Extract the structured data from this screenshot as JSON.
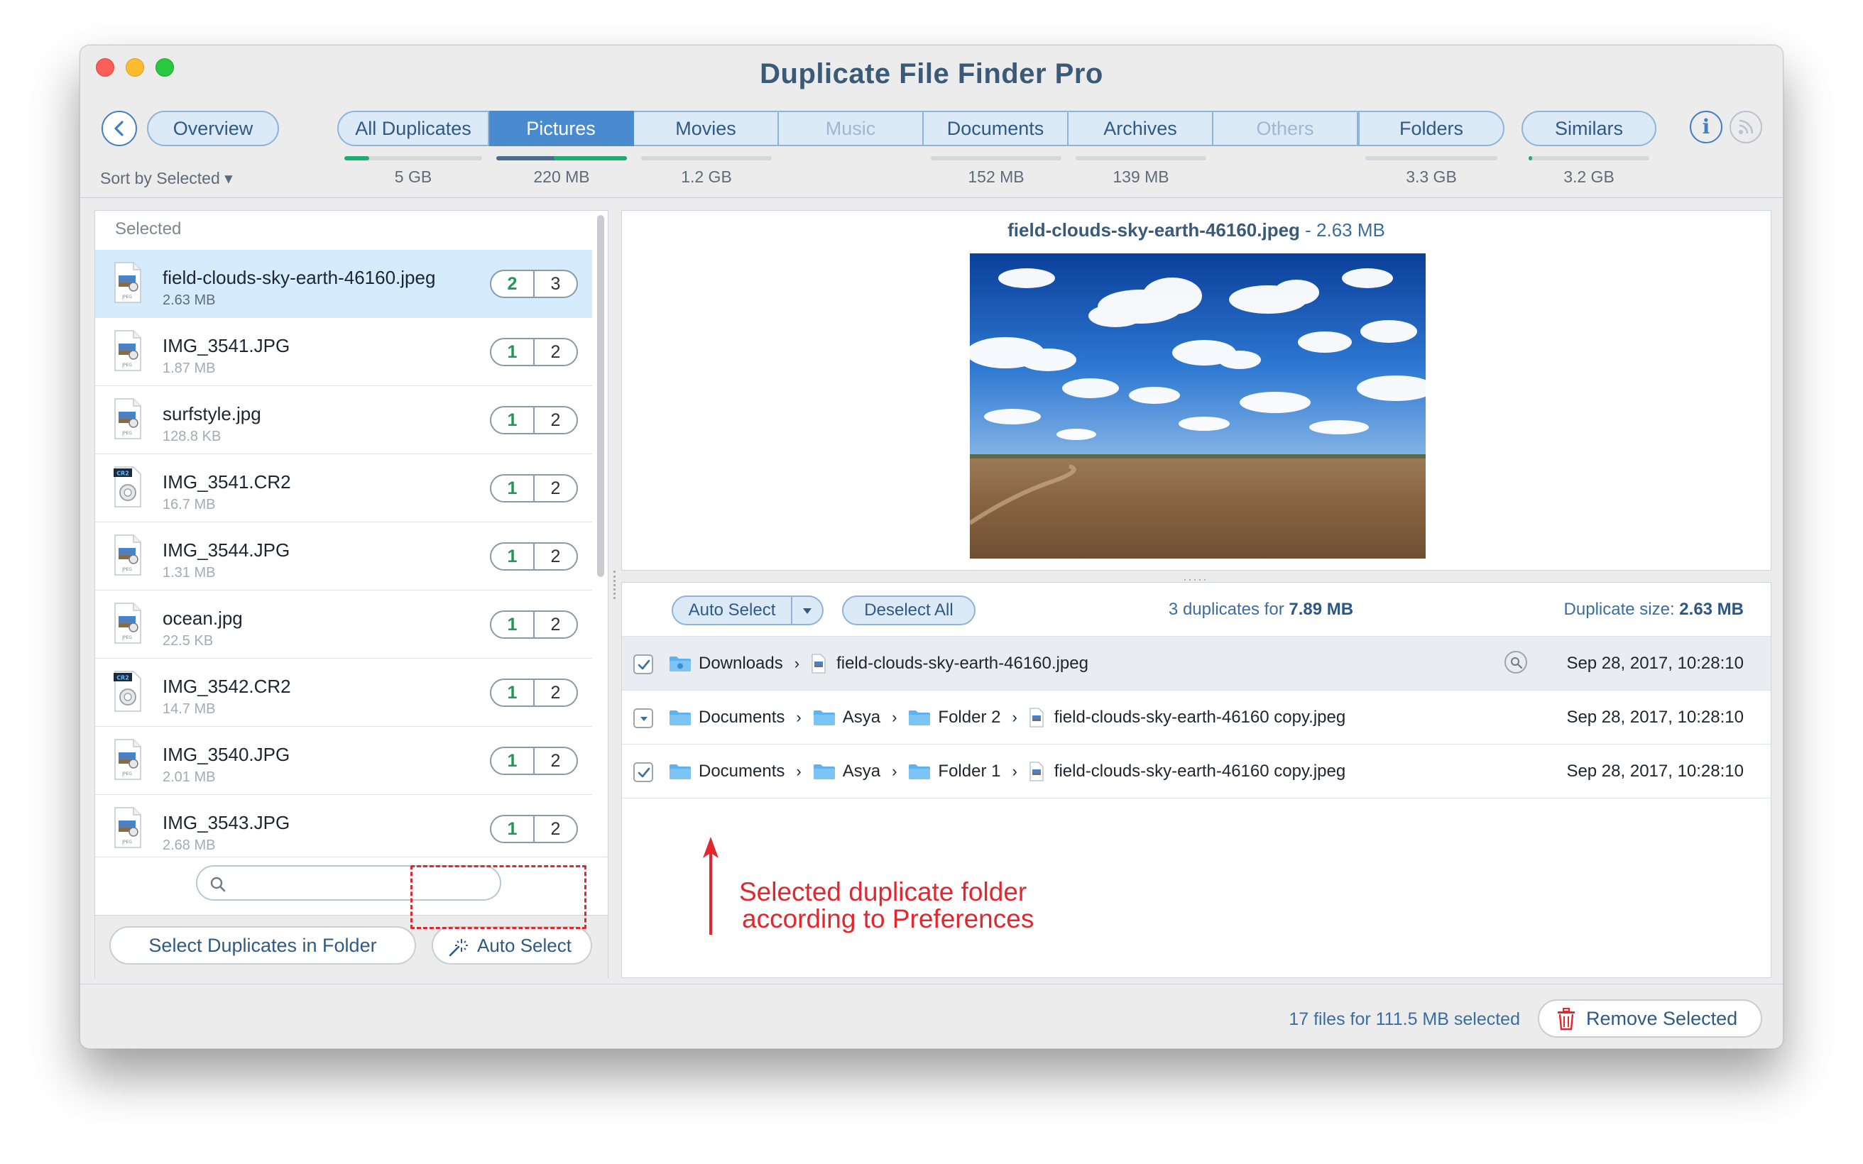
{
  "window": {
    "title": "Duplicate File Finder Pro"
  },
  "toolbar": {
    "tabs": [
      {
        "label": "Overview",
        "size": "",
        "fill": 0,
        "color": "#3dbd8a"
      },
      {
        "label": "All Duplicates",
        "size": "5 GB",
        "fill": 0.18,
        "color": "#1fae72"
      },
      {
        "label": "Pictures",
        "size": "220 MB",
        "fill": 1.0,
        "color": "#1fae72"
      },
      {
        "label": "Movies",
        "size": "1.2 GB",
        "fill": 0,
        "color": "#1fae72"
      },
      {
        "label": "Music",
        "size": "",
        "fill": 0,
        "color": "#1fae72"
      },
      {
        "label": "Documents",
        "size": "152 MB",
        "fill": 0,
        "color": "#1fae72"
      },
      {
        "label": "Archives",
        "size": "139 MB",
        "fill": 0,
        "color": "#1fae72"
      },
      {
        "label": "Others",
        "size": "",
        "fill": 0,
        "color": "#1fae72"
      },
      {
        "label": "Folders",
        "size": "3.3 GB",
        "fill": 0,
        "color": "#1fae72"
      },
      {
        "label": "Similars",
        "size": "3.2 GB",
        "fill": 0.03,
        "color": "#1fae72"
      }
    ],
    "sort_label": "Sort by Selected ▾"
  },
  "list": {
    "header": "Selected",
    "files": [
      {
        "name": "field-clouds-sky-earth-46160.jpeg",
        "size": "2.63 MB",
        "selected_count": "2",
        "total_count": "3",
        "type": "jpeg"
      },
      {
        "name": "IMG_3541.JPG",
        "size": "1.87 MB",
        "selected_count": "1",
        "total_count": "2",
        "type": "jpeg"
      },
      {
        "name": "surfstyle.jpg",
        "size": "128.8 KB",
        "selected_count": "1",
        "total_count": "2",
        "type": "jpeg"
      },
      {
        "name": "IMG_3541.CR2",
        "size": "16.7 MB",
        "selected_count": "1",
        "total_count": "2",
        "type": "cr2"
      },
      {
        "name": "IMG_3544.JPG",
        "size": "1.31 MB",
        "selected_count": "1",
        "total_count": "2",
        "type": "jpeg"
      },
      {
        "name": "ocean.jpg",
        "size": "22.5 KB",
        "selected_count": "1",
        "total_count": "2",
        "type": "jpeg"
      },
      {
        "name": "IMG_3542.CR2",
        "size": "14.7 MB",
        "selected_count": "1",
        "total_count": "2",
        "type": "cr2"
      },
      {
        "name": "IMG_3540.JPG",
        "size": "2.01 MB",
        "selected_count": "1",
        "total_count": "2",
        "type": "jpeg"
      },
      {
        "name": "IMG_3543.JPG",
        "size": "2.68 MB",
        "selected_count": "1",
        "total_count": "2",
        "type": "jpeg"
      }
    ],
    "file_icon_labels": {
      "jpeg": "JPEG",
      "cr2": "CR2"
    },
    "search_placeholder": "",
    "select_in_folder_label": "Select Duplicates in Folder",
    "auto_select_label": "Auto Select"
  },
  "preview": {
    "file_name": "field-clouds-sky-earth-46160.jpeg",
    "size_text": " - 2.63 MB"
  },
  "duplicates": {
    "auto_select_label": "Auto Select",
    "deselect_label": "Deselect All",
    "summary_prefix": "3 duplicates for ",
    "summary_size": "7.89 MB",
    "dup_size_label": "Duplicate size: ",
    "dup_size_value": "2.63 MB",
    "rows": [
      {
        "checked": true,
        "path": [
          "Downloads"
        ],
        "file": "field-clouds-sky-earth-46160.jpeg",
        "date": "Sep 28, 2017, 10:28:10",
        "is_original": true
      },
      {
        "checked": false,
        "path": [
          "Documents",
          "Asya",
          "Folder 2"
        ],
        "file": "field-clouds-sky-earth-46160 copy.jpeg",
        "date": "Sep 28, 2017, 10:28:10",
        "is_original": false
      },
      {
        "checked": true,
        "path": [
          "Documents",
          "Asya",
          "Folder 1"
        ],
        "file": "field-clouds-sky-earth-46160 copy.jpeg",
        "date": "Sep 28, 2017, 10:28:10",
        "is_original": false
      }
    ]
  },
  "annotation": {
    "line1": "Selected duplicate folder",
    "line2": "according to Preferences",
    "color": "#e0282e"
  },
  "footer": {
    "status": "17 files for 111.5 MB selected",
    "remove_label": "Remove Selected"
  }
}
